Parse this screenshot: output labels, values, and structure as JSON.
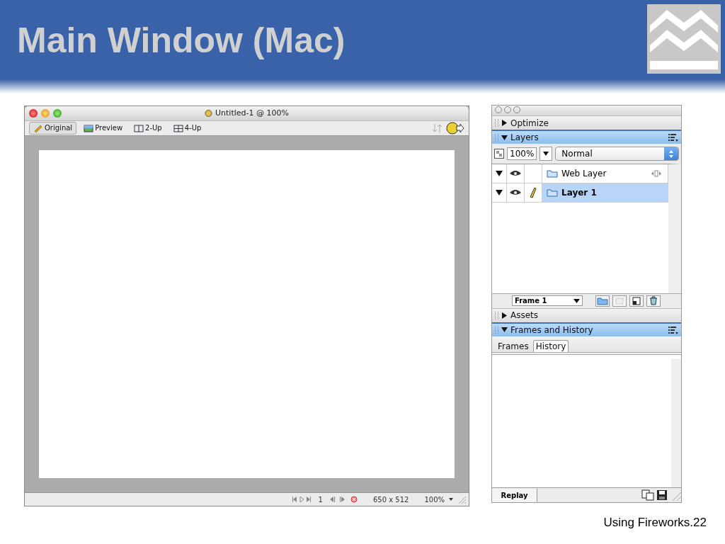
{
  "slide": {
    "title": "Main Window (Mac)",
    "footer": "Using Fireworks.22"
  },
  "document": {
    "title": "Untitled-1 @ 100%",
    "view_tabs": [
      {
        "label": "Original",
        "selected": true
      },
      {
        "label": "Preview",
        "selected": false
      },
      {
        "label": "2-Up",
        "selected": false
      },
      {
        "label": "4-Up",
        "selected": false
      }
    ],
    "status": {
      "frame": "1",
      "size": "650 x 512",
      "zoom": "100%"
    }
  },
  "panel": {
    "optimize": {
      "title": "Optimize",
      "expanded": false
    },
    "layers": {
      "title": "Layers",
      "expanded": true,
      "opacity": "100%",
      "blend": "Normal",
      "frame": "Frame 1",
      "rows": [
        {
          "name": "Web Layer",
          "kind": "web",
          "selected": false,
          "expanded": true
        },
        {
          "name": "Layer 1",
          "kind": "normal",
          "selected": true,
          "expanded": true
        }
      ]
    },
    "assets": {
      "title": "Assets",
      "expanded": false
    },
    "frames_history": {
      "title": "Frames and History",
      "expanded": true,
      "tabs": [
        {
          "label": "Frames",
          "selected": false
        },
        {
          "label": "History",
          "selected": true
        }
      ],
      "replay": "Replay"
    }
  }
}
